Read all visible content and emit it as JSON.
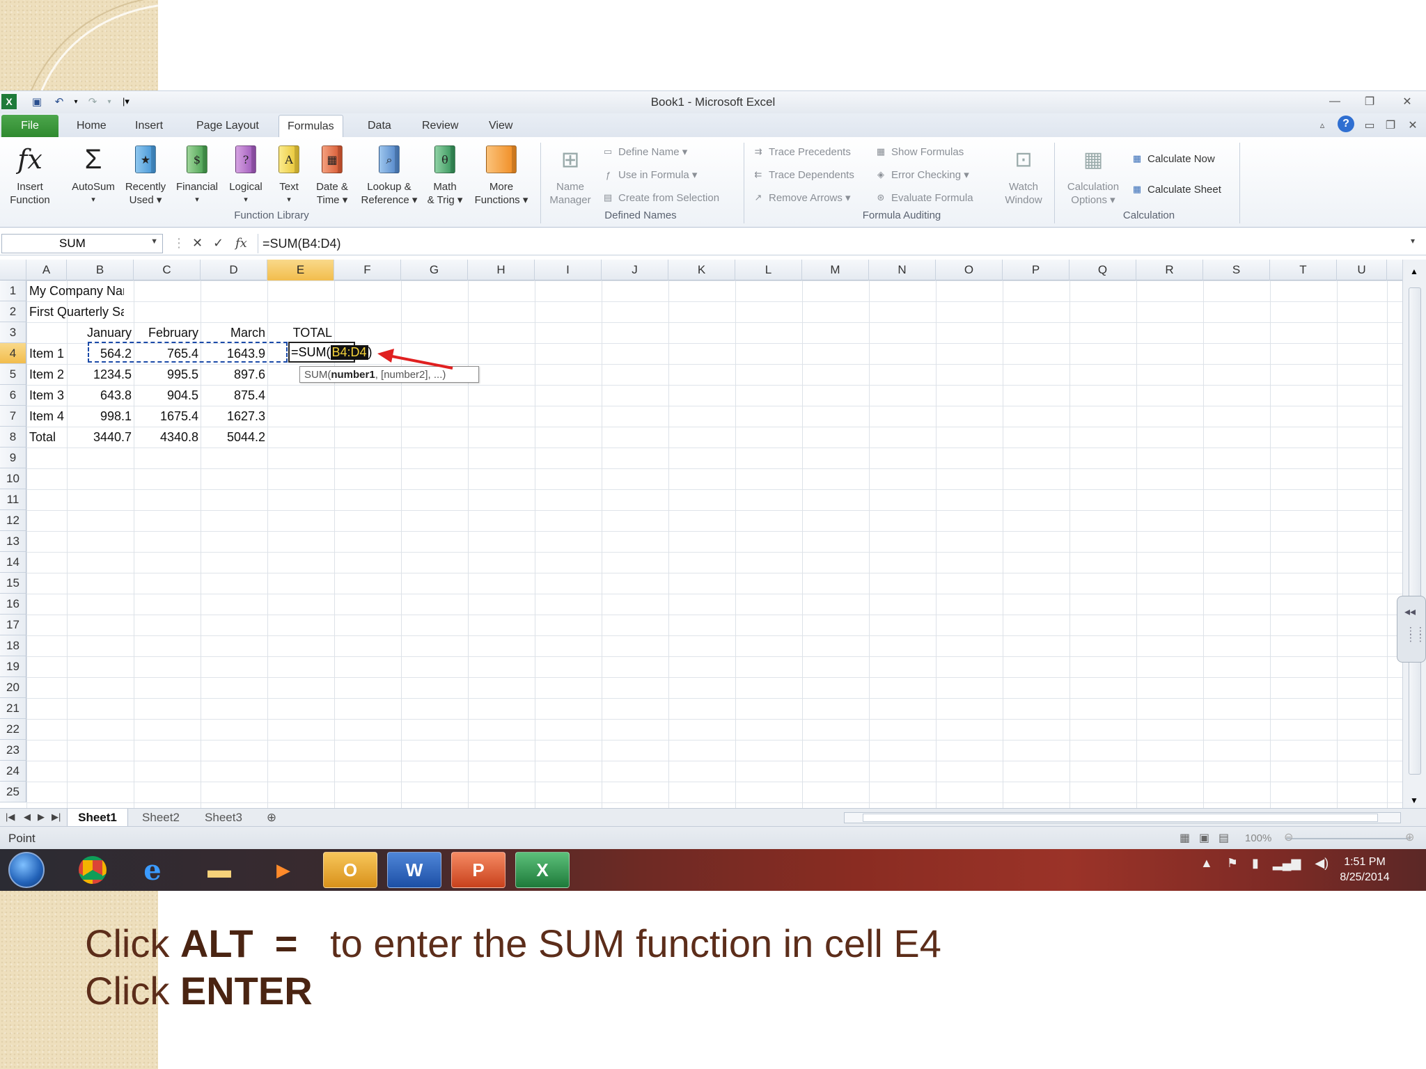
{
  "window": {
    "title": "Book1  -  Microsoft Excel"
  },
  "tabs": [
    "File",
    "Home",
    "Insert",
    "Page Layout",
    "Formulas",
    "Data",
    "Review",
    "View"
  ],
  "active_tab": "Formulas",
  "ribbon": {
    "function_library": {
      "group_label": "Function Library",
      "buttons": [
        {
          "l1": "Insert",
          "l2": "Function",
          "icon": "fx-icon"
        },
        {
          "l1": "AutoSum",
          "l2": "▾",
          "icon": "sigma-icon"
        },
        {
          "l1": "Recently",
          "l2": "Used ▾",
          "icon": "book-star-icon"
        },
        {
          "l1": "Financial",
          "l2": "▾",
          "icon": "book-financial-icon"
        },
        {
          "l1": "Logical",
          "l2": "▾",
          "icon": "book-logical-icon"
        },
        {
          "l1": "Text",
          "l2": "▾",
          "icon": "book-text-icon"
        },
        {
          "l1": "Date &",
          "l2": "Time ▾",
          "icon": "book-date-icon"
        },
        {
          "l1": "Lookup &",
          "l2": "Reference ▾",
          "icon": "book-lookup-icon"
        },
        {
          "l1": "Math",
          "l2": "& Trig ▾",
          "icon": "book-math-icon"
        },
        {
          "l1": "More",
          "l2": "Functions ▾",
          "icon": "books-more-icon"
        }
      ]
    },
    "defined_names": {
      "group_label": "Defined Names",
      "name_manager": {
        "l1": "Name",
        "l2": "Manager"
      },
      "define_name": "Define Name ▾",
      "use_in_formula": "Use in Formula ▾",
      "create_from_selection": "Create from Selection"
    },
    "formula_auditing": {
      "group_label": "Formula Auditing",
      "trace_precedents": "Trace Precedents",
      "trace_dependents": "Trace Dependents",
      "remove_arrows": "Remove Arrows ▾",
      "show_formulas": "Show Formulas",
      "error_checking": "Error Checking ▾",
      "evaluate_formula": "Evaluate Formula",
      "watch_window": {
        "l1": "Watch",
        "l2": "Window"
      }
    },
    "calculation": {
      "group_label": "Calculation",
      "options": {
        "l1": "Calculation",
        "l2": "Options ▾"
      },
      "calculate_now": "Calculate Now",
      "calculate_sheet": "Calculate Sheet"
    }
  },
  "formula_bar": {
    "name_box": "SUM",
    "fx": "fx",
    "formula": "=SUM(B4:D4)"
  },
  "columns": [
    "A",
    "B",
    "C",
    "D",
    "E",
    "F",
    "G",
    "H",
    "I",
    "J",
    "K",
    "L",
    "M",
    "N",
    "O",
    "P",
    "Q",
    "R",
    "S",
    "T",
    "U"
  ],
  "rows": [
    "1",
    "2",
    "3",
    "4",
    "5",
    "6",
    "7",
    "8",
    "9",
    "10",
    "11",
    "12",
    "13",
    "14",
    "15",
    "16",
    "17",
    "18",
    "19",
    "20",
    "21",
    "22",
    "23",
    "24",
    "25"
  ],
  "sheet": {
    "a1": "My Company Name",
    "a2": "First Quarterly Sales",
    "headers": [
      "January",
      "February",
      "March",
      "TOTAL"
    ],
    "items": [
      {
        "label": "Item 1",
        "b": "564.2",
        "c": "765.4",
        "d": "1643.9"
      },
      {
        "label": "Item 2",
        "b": "1234.5",
        "c": "995.5",
        "d": "897.6"
      },
      {
        "label": "Item 3",
        "b": "643.8",
        "c": "904.5",
        "d": "875.4"
      },
      {
        "label": "Item 4",
        "b": "998.1",
        "c": "1675.4",
        "d": "1627.3"
      },
      {
        "label": "Total",
        "b": "3440.7",
        "c": "4340.8",
        "d": "5044.2"
      }
    ],
    "edit_prefix": "=SUM(",
    "edit_range": "B4:D4",
    "edit_suffix": ")",
    "tooltip_fn": "SUM(",
    "tooltip_arg1": "number1",
    "tooltip_rest": ", [number2], ...)"
  },
  "sheet_tabs": [
    "Sheet1",
    "Sheet2",
    "Sheet3"
  ],
  "status": {
    "mode": "Point",
    "zoom": "100%"
  },
  "taskbar": {
    "time": "1:51 PM",
    "date": "8/25/2014"
  },
  "caption": {
    "line1_pre": "Click ",
    "line1_keys": "ALT  =",
    "line1_post": "to enter the SUM function in cell E4",
    "line2_pre": "Click ",
    "line2_key": "ENTER"
  },
  "colors": {
    "accent": "#217346",
    "caption": "#5c2d1a",
    "active_col": "#f2bd4d"
  }
}
